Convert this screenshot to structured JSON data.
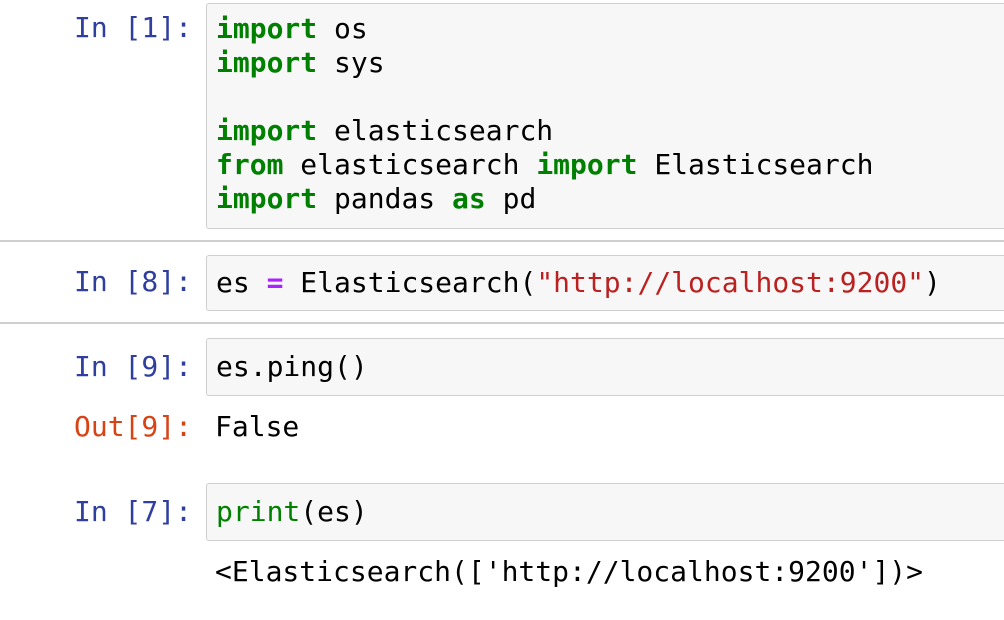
{
  "cells": [
    {
      "prompt": "In [1]:",
      "lines": [
        {
          "kw": "import",
          "rest": " os"
        },
        {
          "kw": "import",
          "rest": " sys"
        },
        {
          "kw": "import",
          "rest": " elasticsearch"
        },
        {
          "kw": "from",
          "mid": " elasticsearch ",
          "kw2": "import",
          "rest": " Elasticsearch"
        },
        {
          "kw": "import",
          "mid": " pandas ",
          "kw2": "as",
          "rest": " pd"
        }
      ]
    },
    {
      "prompt": "In [8]:",
      "lines": [
        {
          "var": "es ",
          "op": "=",
          "call": " Elasticsearch(",
          "str": "\"http://localhost:9200\"",
          "close": ")"
        }
      ]
    },
    {
      "prompt": "In [9]:",
      "lines": [
        {
          "text": "es.ping()"
        }
      ],
      "out_prompt": "Out[9]:",
      "output": "False"
    },
    {
      "prompt": "In [7]:",
      "lines": [
        {
          "fn": "print",
          "rest": "(es)"
        }
      ],
      "stdout": "<Elasticsearch(['http://localhost:9200'])>"
    }
  ],
  "colors": {
    "in_prompt": "#303F9F",
    "out_prompt": "#D84315",
    "keyword": "#008000",
    "string": "#BA2121",
    "operator": "#AA22FF",
    "code_bg": "#f7f7f7"
  }
}
